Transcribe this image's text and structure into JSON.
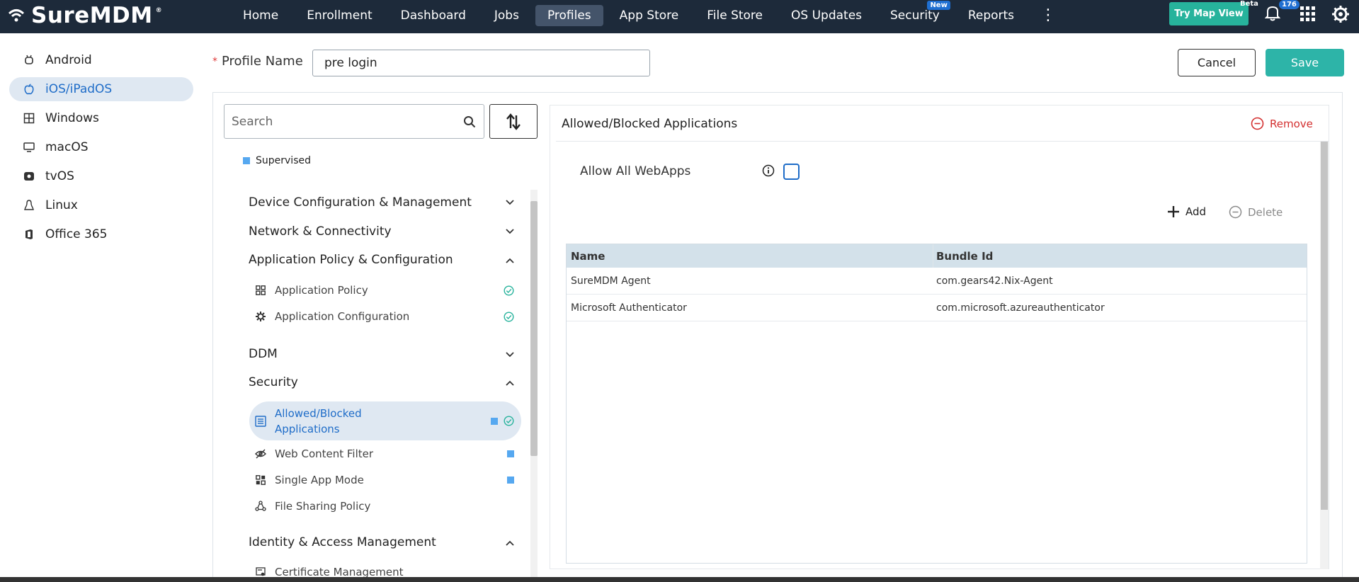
{
  "header": {
    "brand": "SureMDM",
    "brand_mark": "®",
    "nav": [
      {
        "label": "Home",
        "active": false
      },
      {
        "label": "Enrollment",
        "active": false
      },
      {
        "label": "Dashboard",
        "active": false
      },
      {
        "label": "Jobs",
        "active": false
      },
      {
        "label": "Profiles",
        "active": true
      },
      {
        "label": "App Store",
        "active": false
      },
      {
        "label": "File Store",
        "active": false
      },
      {
        "label": "OS Updates",
        "active": false
      },
      {
        "label": "Security",
        "active": false,
        "badge": "New"
      },
      {
        "label": "Reports",
        "active": false
      }
    ],
    "try_map_view": "Try Map View",
    "beta_label": "Beta",
    "notification_count": "176",
    "icons": [
      "wifi-logo-icon",
      "more-vertical-icon",
      "bell-icon",
      "apps-grid-icon",
      "gear-icon"
    ]
  },
  "os_sidebar": {
    "items": [
      {
        "label": "Android",
        "icon": "android-icon",
        "active": false
      },
      {
        "label": "iOS/iPadOS",
        "icon": "apple-icon",
        "active": true
      },
      {
        "label": "Windows",
        "icon": "windows-icon",
        "active": false
      },
      {
        "label": "macOS",
        "icon": "monitor-icon",
        "active": false
      },
      {
        "label": "tvOS",
        "icon": "tv-icon",
        "active": false
      },
      {
        "label": "Linux",
        "icon": "linux-icon",
        "active": false
      },
      {
        "label": "Office 365",
        "icon": "office-icon",
        "active": false
      }
    ]
  },
  "profile": {
    "name_label": "Profile Name",
    "required_mark": "*",
    "name_value": "pre login",
    "cancel_label": "Cancel",
    "save_label": "Save"
  },
  "policy_tree": {
    "search_placeholder": "Search",
    "legend_label": "Supervised",
    "legend_color": "#56a8f0",
    "categories": [
      {
        "label": "Device Configuration & Management",
        "expanded": false
      },
      {
        "label": "Network & Connectivity",
        "expanded": false
      },
      {
        "label": "Application Policy & Configuration",
        "expanded": true,
        "children": [
          {
            "label": "Application Policy",
            "icon": "grid-icon",
            "configured": true,
            "supervised": false
          },
          {
            "label": "Application Configuration",
            "icon": "gear-icon",
            "configured": true,
            "supervised": false
          }
        ]
      },
      {
        "label": "DDM",
        "expanded": false
      },
      {
        "label": "Security",
        "expanded": true,
        "children": [
          {
            "label": "Allowed/Blocked Applications",
            "icon": "list-icon",
            "configured": true,
            "supervised": true,
            "active": true
          },
          {
            "label": "Web Content Filter",
            "icon": "eye-off-icon",
            "configured": false,
            "supervised": true
          },
          {
            "label": "Single App Mode",
            "icon": "app-grid-icon",
            "configured": false,
            "supervised": true
          },
          {
            "label": "File Sharing Policy",
            "icon": "share-icon",
            "configured": false,
            "supervised": false
          }
        ]
      },
      {
        "label": "Identity & Access Management",
        "expanded": true,
        "children": [
          {
            "label": "Certificate Management",
            "icon": "certificate-icon",
            "configured": false,
            "supervised": false
          }
        ]
      }
    ]
  },
  "content": {
    "title": "Allowed/Blocked Applications",
    "remove_label": "Remove",
    "allow_webapps_label": "Allow All WebApps",
    "allow_webapps_checked": false,
    "add_label": "Add",
    "delete_label": "Delete",
    "table": {
      "columns": [
        "Name",
        "Bundle Id"
      ],
      "rows": [
        [
          "SureMDM Agent",
          "com.gears42.Nix-Agent"
        ],
        [
          "Microsoft Authenticator",
          "com.microsoft.azureauthenticator"
        ]
      ]
    }
  },
  "colors": {
    "topbar": "#1d2a3a",
    "accent": "#1e6cc8",
    "save": "#2db4a8",
    "remove": "#d32f2f"
  }
}
